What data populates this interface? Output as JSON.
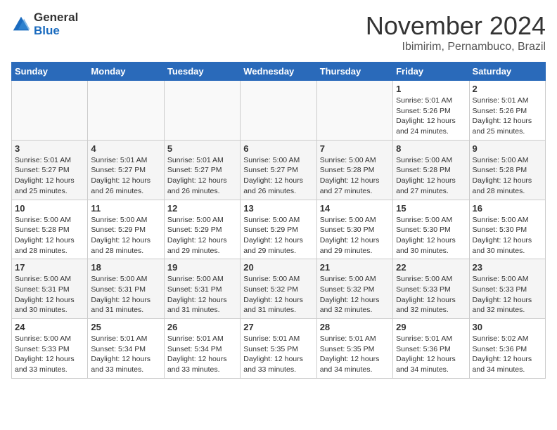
{
  "header": {
    "logo_general": "General",
    "logo_blue": "Blue",
    "month_title": "November 2024",
    "location": "Ibimirim, Pernambuco, Brazil"
  },
  "weekdays": [
    "Sunday",
    "Monday",
    "Tuesday",
    "Wednesday",
    "Thursday",
    "Friday",
    "Saturday"
  ],
  "weeks": [
    [
      {
        "day": "",
        "info": ""
      },
      {
        "day": "",
        "info": ""
      },
      {
        "day": "",
        "info": ""
      },
      {
        "day": "",
        "info": ""
      },
      {
        "day": "",
        "info": ""
      },
      {
        "day": "1",
        "info": "Sunrise: 5:01 AM\nSunset: 5:26 PM\nDaylight: 12 hours and 24 minutes."
      },
      {
        "day": "2",
        "info": "Sunrise: 5:01 AM\nSunset: 5:26 PM\nDaylight: 12 hours and 25 minutes."
      }
    ],
    [
      {
        "day": "3",
        "info": "Sunrise: 5:01 AM\nSunset: 5:27 PM\nDaylight: 12 hours and 25 minutes."
      },
      {
        "day": "4",
        "info": "Sunrise: 5:01 AM\nSunset: 5:27 PM\nDaylight: 12 hours and 26 minutes."
      },
      {
        "day": "5",
        "info": "Sunrise: 5:01 AM\nSunset: 5:27 PM\nDaylight: 12 hours and 26 minutes."
      },
      {
        "day": "6",
        "info": "Sunrise: 5:00 AM\nSunset: 5:27 PM\nDaylight: 12 hours and 26 minutes."
      },
      {
        "day": "7",
        "info": "Sunrise: 5:00 AM\nSunset: 5:28 PM\nDaylight: 12 hours and 27 minutes."
      },
      {
        "day": "8",
        "info": "Sunrise: 5:00 AM\nSunset: 5:28 PM\nDaylight: 12 hours and 27 minutes."
      },
      {
        "day": "9",
        "info": "Sunrise: 5:00 AM\nSunset: 5:28 PM\nDaylight: 12 hours and 28 minutes."
      }
    ],
    [
      {
        "day": "10",
        "info": "Sunrise: 5:00 AM\nSunset: 5:28 PM\nDaylight: 12 hours and 28 minutes."
      },
      {
        "day": "11",
        "info": "Sunrise: 5:00 AM\nSunset: 5:29 PM\nDaylight: 12 hours and 28 minutes."
      },
      {
        "day": "12",
        "info": "Sunrise: 5:00 AM\nSunset: 5:29 PM\nDaylight: 12 hours and 29 minutes."
      },
      {
        "day": "13",
        "info": "Sunrise: 5:00 AM\nSunset: 5:29 PM\nDaylight: 12 hours and 29 minutes."
      },
      {
        "day": "14",
        "info": "Sunrise: 5:00 AM\nSunset: 5:30 PM\nDaylight: 12 hours and 29 minutes."
      },
      {
        "day": "15",
        "info": "Sunrise: 5:00 AM\nSunset: 5:30 PM\nDaylight: 12 hours and 30 minutes."
      },
      {
        "day": "16",
        "info": "Sunrise: 5:00 AM\nSunset: 5:30 PM\nDaylight: 12 hours and 30 minutes."
      }
    ],
    [
      {
        "day": "17",
        "info": "Sunrise: 5:00 AM\nSunset: 5:31 PM\nDaylight: 12 hours and 30 minutes."
      },
      {
        "day": "18",
        "info": "Sunrise: 5:00 AM\nSunset: 5:31 PM\nDaylight: 12 hours and 31 minutes."
      },
      {
        "day": "19",
        "info": "Sunrise: 5:00 AM\nSunset: 5:31 PM\nDaylight: 12 hours and 31 minutes."
      },
      {
        "day": "20",
        "info": "Sunrise: 5:00 AM\nSunset: 5:32 PM\nDaylight: 12 hours and 31 minutes."
      },
      {
        "day": "21",
        "info": "Sunrise: 5:00 AM\nSunset: 5:32 PM\nDaylight: 12 hours and 32 minutes."
      },
      {
        "day": "22",
        "info": "Sunrise: 5:00 AM\nSunset: 5:33 PM\nDaylight: 12 hours and 32 minutes."
      },
      {
        "day": "23",
        "info": "Sunrise: 5:00 AM\nSunset: 5:33 PM\nDaylight: 12 hours and 32 minutes."
      }
    ],
    [
      {
        "day": "24",
        "info": "Sunrise: 5:00 AM\nSunset: 5:33 PM\nDaylight: 12 hours and 33 minutes."
      },
      {
        "day": "25",
        "info": "Sunrise: 5:01 AM\nSunset: 5:34 PM\nDaylight: 12 hours and 33 minutes."
      },
      {
        "day": "26",
        "info": "Sunrise: 5:01 AM\nSunset: 5:34 PM\nDaylight: 12 hours and 33 minutes."
      },
      {
        "day": "27",
        "info": "Sunrise: 5:01 AM\nSunset: 5:35 PM\nDaylight: 12 hours and 33 minutes."
      },
      {
        "day": "28",
        "info": "Sunrise: 5:01 AM\nSunset: 5:35 PM\nDaylight: 12 hours and 34 minutes."
      },
      {
        "day": "29",
        "info": "Sunrise: 5:01 AM\nSunset: 5:36 PM\nDaylight: 12 hours and 34 minutes."
      },
      {
        "day": "30",
        "info": "Sunrise: 5:02 AM\nSunset: 5:36 PM\nDaylight: 12 hours and 34 minutes."
      }
    ]
  ]
}
